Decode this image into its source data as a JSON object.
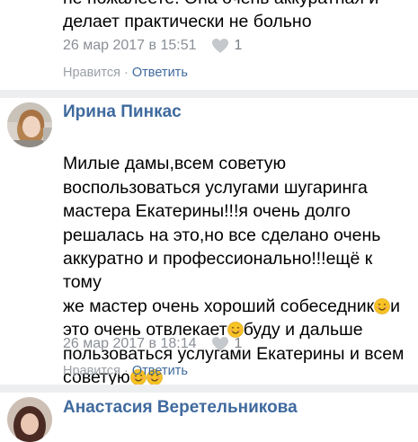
{
  "comments": [
    {
      "text": "не пожалеете. Она очень аккуратная и\nделает практически не больно",
      "date": "26 мар 2017 в 15:51",
      "likes": "1",
      "like_label": "Нравится",
      "separator": "·",
      "reply_label": "Ответить"
    },
    {
      "author": "Ирина Пинкас",
      "text_parts": [
        "Милые дамы,всем советую\nвоспользоваться услугами шугаринга\nмастера Екатерины!!!я очень долго\nрешалась на это,но все сделано очень\nаккуратно и профессионально!!!ещё к тому\nже мастер очень хороший собеседник",
        "и\nэто очень отвлекает",
        "буду и дальше\nпользоваться услугами Екатерины и всем\nсоветую"
      ],
      "date": "26 мар 2017 в 18:14",
      "likes": "1",
      "like_label": "Нравится",
      "separator": "·",
      "reply_label": "Ответить"
    },
    {
      "author": "Анастасия Веретельникова"
    }
  ],
  "icons": {
    "like": "heart-icon",
    "smile": "smiling-face-emoji",
    "wink": "winking-face-emoji"
  },
  "colors": {
    "author": "#3f6a9e",
    "meta": "#8a8f96",
    "separator": "#edeef0",
    "emoji": "#f7c325"
  }
}
